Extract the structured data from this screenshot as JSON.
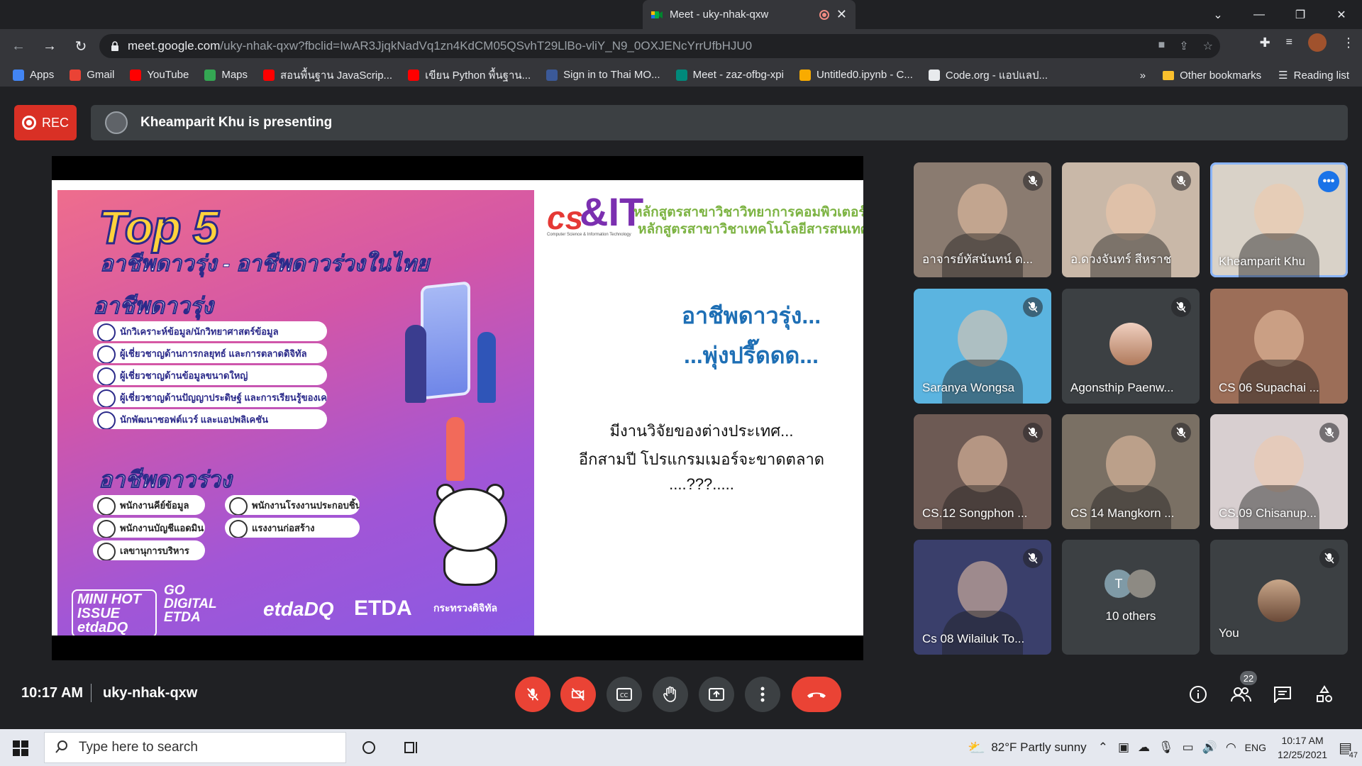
{
  "browser": {
    "tab_title": "Meet - uky-nhak-qxw",
    "url_host": "meet.google.com",
    "url_path": "/uky-nhak-qxw?fbclid=IwAR3JjqkNadVq1zn4KdCM05QSvhT29LlBo-vliY_N9_0OXJENcYrrUfbHJU0",
    "bookmarks": [
      {
        "label": "Apps",
        "color": "#4285f4"
      },
      {
        "label": "Gmail",
        "color": "#ea4335"
      },
      {
        "label": "YouTube",
        "color": "#ff0000"
      },
      {
        "label": "Maps",
        "color": "#34a853"
      },
      {
        "label": "สอนพื้นฐาน JavaScrip...",
        "color": "#ff0000"
      },
      {
        "label": "เขียน Python พื้นฐาน...",
        "color": "#ff0000"
      },
      {
        "label": "Sign in to Thai MO...",
        "color": "#3b5998"
      },
      {
        "label": "Meet - zaz-ofbg-xpi",
        "color": "#00897b"
      },
      {
        "label": "Untitled0.ipynb - C...",
        "color": "#f9ab00"
      },
      {
        "label": "Code.org - แอปแลป...",
        "color": "#e8eaed"
      }
    ],
    "more_bookmarks": "»",
    "other_bookmarks": "Other bookmarks",
    "reading_list": "Reading list"
  },
  "meet": {
    "rec_label": "REC",
    "presenting_text": "Kheamparit Khu is presenting",
    "time": "10:17 AM",
    "meeting_code": "uky-nhak-qxw",
    "participants_count": "22"
  },
  "slide": {
    "poster_top": "Top 5",
    "poster_subtitle": "อาชีพดาวรุ่ง - อาชีพดาวร่วงในไทย",
    "poster_rising": "อาชีพดาวรุ่ง",
    "poster_falling": "อาชีพดาวร่วง",
    "rising_items": [
      "นักวิเคราะห์ข้อมูล/นักวิทยาศาสตร์ข้อมูล",
      "ผู้เชี่ยวชาญด้านการกลยุทธ์ และการตลาดดิจิทัล",
      "ผู้เชี่ยวชาญด้านข้อมูลขนาดใหญ่",
      "ผู้เชี่ยวชาญด้านปัญญาประดิษฐ์ และการเรียนรู้ของเครื่องจักร",
      "นักพัฒนาซอฟต์แวร์ และแอปพลิเคชัน"
    ],
    "falling_items_left": [
      "พนักงานคีย์ข้อมูล",
      "พนักงานบัญชีแอดมิน",
      "เลขานุการบริหาร"
    ],
    "falling_items_right": [
      "พนักงานโรงงานประกอบชิ้นส่วน",
      "แรงงานก่อสร้าง"
    ],
    "logo_hot": "MINI HOT ISSUE etdaDQ",
    "logo_go": "GO DIGITAL ETDA",
    "logo_etdadq": "etdaDQ",
    "logo_etda": "ETDA",
    "logo_ministry": "กระทรวงดิจิทัล",
    "csit_title1": "หลักสูตรสาขาวิชาวิทยาการคอมพิวเตอร์",
    "csit_title2": "หลักสูตรสาขาวิชาเทคโนโลยีสารสนเทศ",
    "csit_small": "Computer Science & Information Technology",
    "headline1": "อาชีพดาวรุ่ง...",
    "headline2": "...พุ่งปรี๊ดดด...",
    "body1": "มีงานวิจัยของต่างประเทศ...",
    "body2": "อีกสามปี โปรแกรมเมอร์จะขาดตลาด",
    "body3": "....???....."
  },
  "participants": [
    {
      "name": "อาจารย์ทัสนันทน์ ด...",
      "muted": true,
      "bg": "#8a7b70"
    },
    {
      "name": "อ.ดวงจันทร์ สีหราช",
      "muted": true,
      "bg": "#c9b8a8"
    },
    {
      "name": "Kheamparit Khu",
      "muted": false,
      "bg": "#d9d2c8",
      "active": true
    },
    {
      "name": "Saranya Wongsa",
      "muted": true,
      "bg": "#5bb4e0"
    },
    {
      "name": "Agonsthip Paenw...",
      "muted": true,
      "bg": "#3c4043"
    },
    {
      "name": "CS 06 Supachai ...",
      "muted": false,
      "bg": "#9c6e58"
    },
    {
      "name": "CS.12 Songphon ...",
      "muted": true,
      "bg": "#6d5a54"
    },
    {
      "name": "CS 14 Mangkorn ...",
      "muted": true,
      "bg": "#7a7064"
    },
    {
      "name": "CS.09 Chisanup...",
      "muted": true,
      "bg": "#d8cfd0"
    },
    {
      "name": "Cs 08 Wilailuk To...",
      "muted": true,
      "bg": "#3a3f6b"
    },
    {
      "name": "10 others",
      "muted": false,
      "bg": "#3c4043"
    },
    {
      "name": "You",
      "muted": true,
      "bg": "#3c4043"
    }
  ],
  "others_initial": "T",
  "taskbar": {
    "search_placeholder": "Type here to search",
    "weather": "82°F  Partly sunny",
    "lang": "ENG",
    "time": "10:17 AM",
    "date": "12/25/2021",
    "notif": "47"
  }
}
